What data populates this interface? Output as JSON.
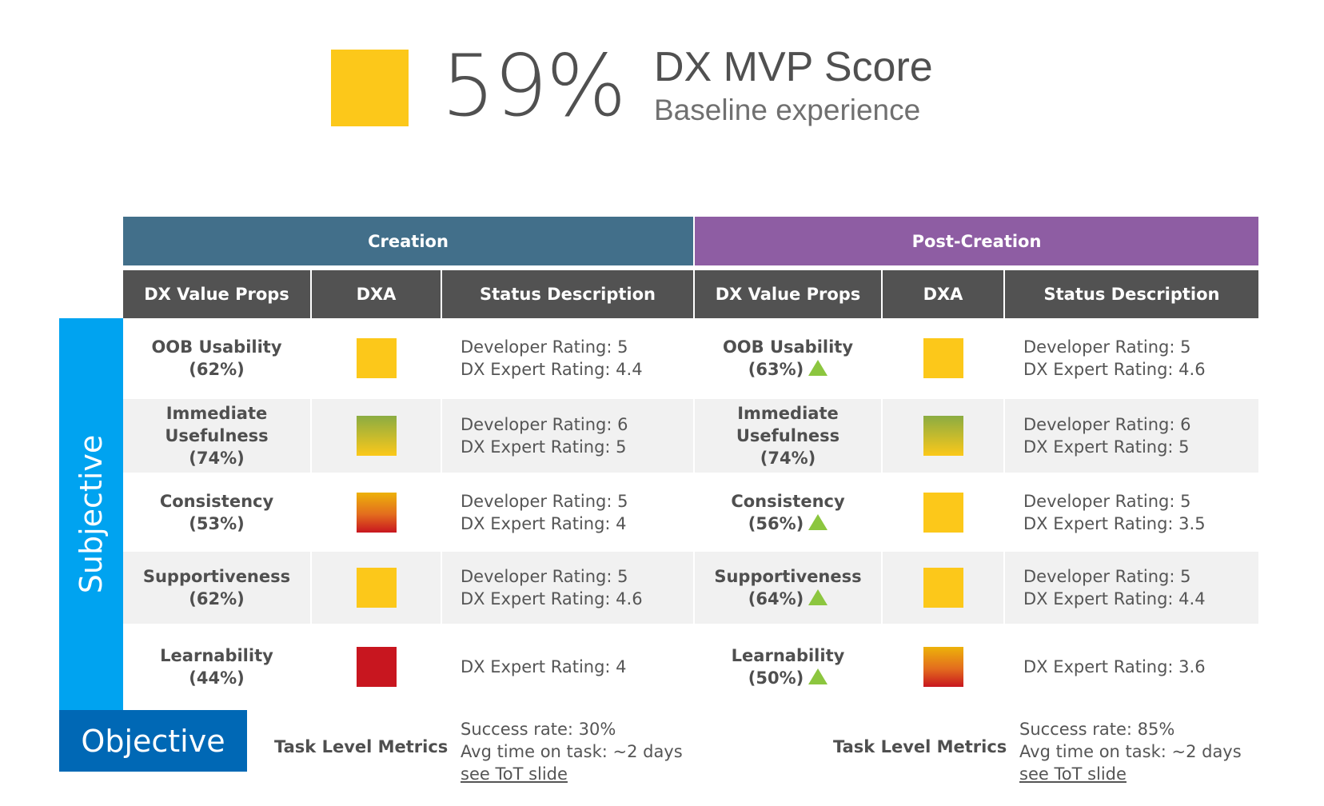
{
  "header": {
    "score_value": "59%",
    "score_color": "#FCC81A",
    "title": "DX MVP Score",
    "subtitle": "Baseline experience"
  },
  "sections": [
    {
      "label": "Creation",
      "color": "#426F8A"
    },
    {
      "label": "Post-Creation",
      "color": "#8E5DA3"
    }
  ],
  "columns": [
    "DX Value Props",
    "DXA",
    "Status Description"
  ],
  "categories": {
    "subjective": "Subjective",
    "objective": "Objective"
  },
  "rows": [
    {
      "creation": {
        "name": "OOB Usability",
        "pct": "(62%)",
        "trend_up": false,
        "dxa": "yellow",
        "status": [
          "Developer Rating: 5",
          "DX Expert Rating: 4.4"
        ]
      },
      "post": {
        "name": "OOB Usability",
        "pct": "(63%)",
        "trend_up": true,
        "dxa": "yellow",
        "status": [
          "Developer Rating: 5",
          "DX Expert Rating: 4.6"
        ]
      }
    },
    {
      "creation": {
        "name": "Immediate Usefulness",
        "pct": "(74%)",
        "trend_up": false,
        "dxa": "green-yellow",
        "status": [
          "Developer Rating: 6",
          "DX Expert Rating: 5"
        ]
      },
      "post": {
        "name": "Immediate Usefulness",
        "pct": "(74%)",
        "trend_up": false,
        "dxa": "green-yellow",
        "status": [
          "Developer Rating: 6",
          "DX Expert Rating: 5"
        ]
      }
    },
    {
      "creation": {
        "name": "Consistency",
        "pct": "(53%)",
        "trend_up": false,
        "dxa": "yellow-red",
        "status": [
          "Developer Rating: 5",
          "DX Expert Rating: 4"
        ]
      },
      "post": {
        "name": "Consistency",
        "pct": "(56%)",
        "trend_up": true,
        "dxa": "yellow",
        "status": [
          "Developer Rating: 5",
          "DX Expert Rating: 3.5"
        ]
      }
    },
    {
      "creation": {
        "name": "Supportiveness",
        "pct": "(62%)",
        "trend_up": false,
        "dxa": "yellow",
        "status": [
          "Developer Rating: 5",
          "DX Expert Rating: 4.6"
        ]
      },
      "post": {
        "name": "Supportiveness",
        "pct": "(64%)",
        "trend_up": true,
        "dxa": "yellow",
        "status": [
          "Developer Rating: 5",
          "DX Expert Rating: 4.4"
        ]
      }
    },
    {
      "creation": {
        "name": "Learnability",
        "pct": "(44%)",
        "trend_up": false,
        "dxa": "red",
        "status": [
          "DX Expert Rating: 4"
        ]
      },
      "post": {
        "name": "Learnability",
        "pct": "(50%)",
        "trend_up": true,
        "dxa": "yellow-red",
        "status": [
          "DX Expert Rating: 3.6"
        ]
      }
    }
  ],
  "objective": {
    "creation": {
      "label": "Task Level Metrics",
      "lines": [
        "Success rate: 30%",
        "Avg time on task: ~2 days"
      ],
      "link": "see ToT slide"
    },
    "post": {
      "label": "Task Level Metrics",
      "lines": [
        "Success rate: 85%",
        "Avg time on task: ~2 days"
      ],
      "link": "see ToT slide"
    }
  },
  "dxa_colors": {
    "yellow": "#FCC81A",
    "green-yellow": "linear-gradient(#8BAC42,#FCC81A)",
    "yellow-red": "linear-gradient(#EDB20A,#E36C1E 55%,#C8161F)",
    "red": "#C8161F"
  },
  "trend_color": "#8CC63F"
}
